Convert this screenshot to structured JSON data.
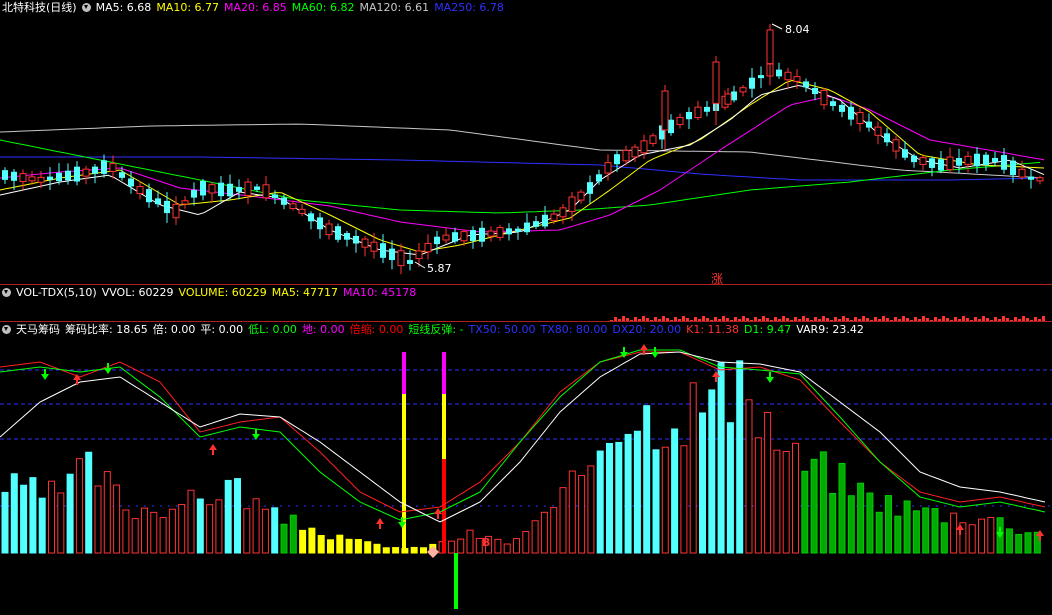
{
  "main": {
    "title": "北特科技(日线)",
    "ma": [
      {
        "label": "MA5: 6.68",
        "color": "#ffffff"
      },
      {
        "label": "MA10: 6.77",
        "color": "#ffff00"
      },
      {
        "label": "MA20: 6.85",
        "color": "#ff00ff"
      },
      {
        "label": "MA60: 6.82",
        "color": "#00ff00"
      },
      {
        "label": "MA120: 6.61",
        "color": "#c8c8c8"
      },
      {
        "label": "MA250: 6.78",
        "color": "#3030ff"
      }
    ],
    "high_label": "8.04",
    "low_label": "5.87",
    "badge": "涨"
  },
  "vol": {
    "title": "VOL-TDX(5,10)",
    "items": [
      {
        "label": "VVOL: 60229",
        "color": "#ffffff"
      },
      {
        "label": "VOLUME: 60229",
        "color": "#ffff00"
      },
      {
        "label": "MA5: 47717",
        "color": "#ffff00"
      },
      {
        "label": "MA10: 45178",
        "color": "#ff00ff"
      }
    ]
  },
  "ind": {
    "title": "天马筹码",
    "items": [
      {
        "label": "筹码比率: 18.65",
        "color": "#ffffff"
      },
      {
        "label": "倍: 0.00",
        "color": "#ffffff"
      },
      {
        "label": "平: 0.00",
        "color": "#ffffff"
      },
      {
        "label": "低L: 0.00",
        "color": "#00ff00"
      },
      {
        "label": "地: 0.00",
        "color": "#ff00ff"
      },
      {
        "label": "倍缩: 0.00",
        "color": "#ff0000"
      },
      {
        "label": "短线反弹: -",
        "color": "#00ff00"
      },
      {
        "label": "TX50: 50.00",
        "color": "#3030ff"
      },
      {
        "label": "TX80: 80.00",
        "color": "#3030ff"
      },
      {
        "label": "DX20: 20.00",
        "color": "#3030ff"
      },
      {
        "label": "K1: 11.38",
        "color": "#ff3030"
      },
      {
        "label": "D1: 9.47",
        "color": "#00ff00"
      },
      {
        "label": "VAR9: 23.42",
        "color": "#ffffff"
      }
    ],
    "marker": "B"
  }
}
